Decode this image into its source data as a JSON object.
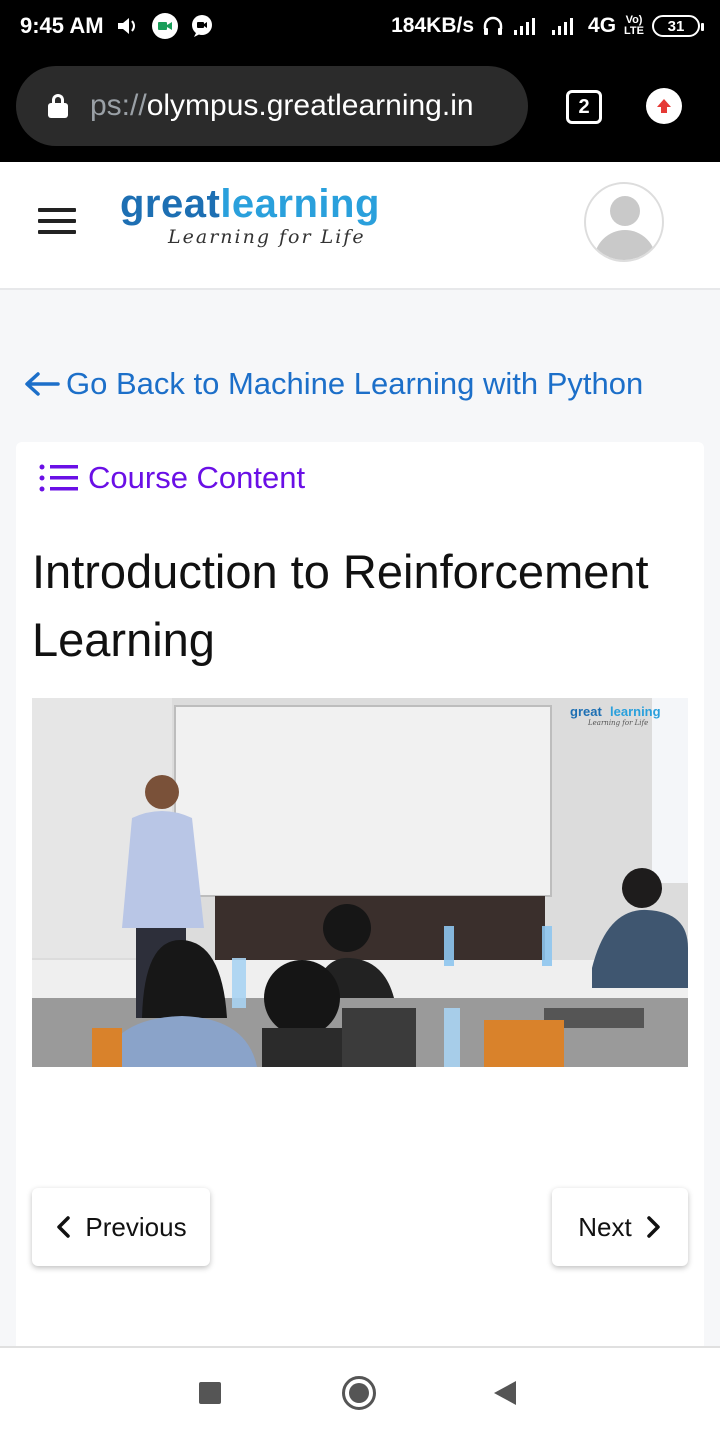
{
  "status_bar": {
    "time": "9:45 AM",
    "net_speed": "184KB/s",
    "network": "4G",
    "volte_top": "Vo)",
    "volte_bottom": "LTE",
    "battery": "31"
  },
  "browser": {
    "url_scheme": "ps://",
    "url_host": "olympus.greatlearning.in",
    "tab_count": "2"
  },
  "header": {
    "logo_great": "great",
    "logo_learning": "learning",
    "tagline": "Learning for Life"
  },
  "back_link": {
    "label": "Go Back to Machine Learning with Python"
  },
  "card": {
    "course_content_label": "Course Content",
    "lesson_title": "Introduction to Reinforcement Learning",
    "video": {
      "watermark_great": "great",
      "watermark_learning": "learning",
      "watermark_tagline": "Learning for Life"
    },
    "previous_label": "Previous",
    "next_label": "Next"
  },
  "colors": {
    "link_blue": "#1c6fc9",
    "course_purple": "#6a0fe6",
    "logo_dark_blue": "#1d6fb3",
    "logo_light_blue": "#2aa0dc"
  }
}
